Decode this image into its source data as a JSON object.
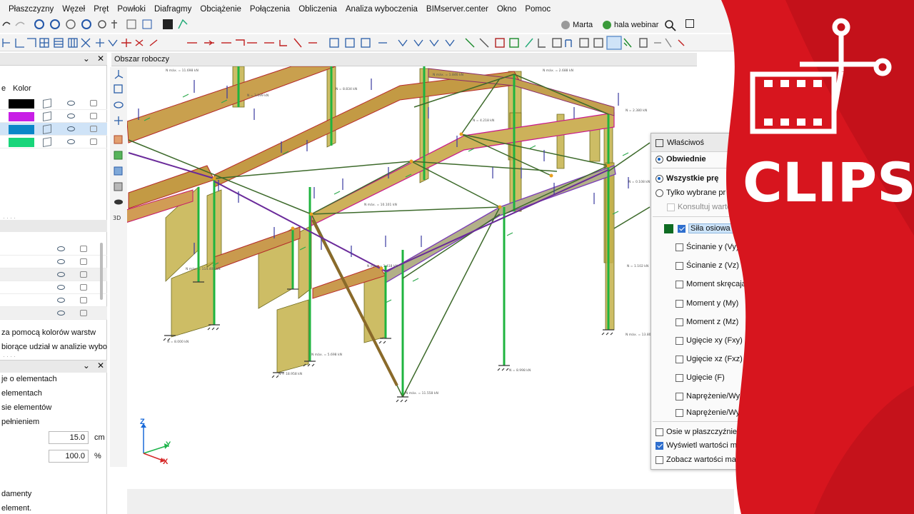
{
  "menu": [
    "Płaszczyzny",
    "Węzeł",
    "Pręt",
    "Powłoki",
    "Diafragmy",
    "Obciążenie",
    "Połączenia",
    "Obliczenia",
    "Analiza wyboczenia",
    "BIMserver.center",
    "Okno",
    "Pomoc"
  ],
  "user": {
    "name": "Marta",
    "project": "hala webinar"
  },
  "workspace_tab": "Obszar roboczy",
  "layers": {
    "header_prefix": "e",
    "color_header": "Kolor",
    "colors": [
      "#000000",
      "#c81ee6",
      "#0a86c8",
      "#18d57a"
    ]
  },
  "left_texts": {
    "color_layers": "za pomocą kolorów warstw",
    "buckling": "biorące udział w analizie wybo",
    "elements_info": "je o elementach",
    "elements": "elementach",
    "elements_axes": "sie elementów",
    "filled": "pełnieniem",
    "value1": "15.0",
    "unit1": "cm",
    "value2": "100.0",
    "unit2": "%",
    "foundations": "damenty",
    "element": "element."
  },
  "properties": {
    "title": "Właściwoś",
    "envelopes": "Obwiednie",
    "all_bars": "Wszystkie prę",
    "selected_bars": "Tylko wybrane pr",
    "consult": "Konsultuj warto",
    "items": [
      "Siła osiowa (N",
      "Ścinanie y (Vy)",
      "Ścinanie z (Vz)",
      "Moment skręcają",
      "Moment y (My)",
      "Moment z (Mz)",
      "Ugięcie xy (Fxy)",
      "Ugięcie xz (Fxz)",
      "Ugięcie (F)",
      "Naprężenie/Wykorz",
      "Naprężenie/Wykorz"
    ],
    "axes_plane": "Osie w płaszczyźnie okna",
    "show_max": "Wyświetl wartości maksy",
    "see_max": "Zobacz wartości maksym"
  },
  "axes": {
    "z": "Z",
    "y": "Y",
    "x": "X"
  },
  "brand": {
    "text": "CLIPS",
    "color": "#d7151e"
  }
}
